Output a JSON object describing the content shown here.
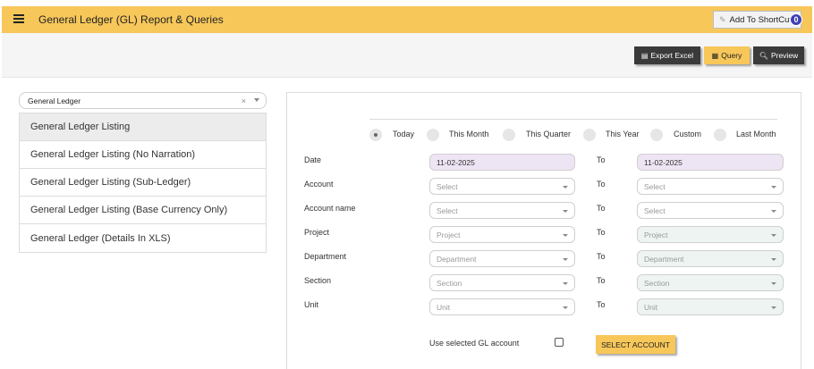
{
  "header": {
    "title": "General Ledger (GL) Report & Queries",
    "shortcut_label": "Add To ShortCut",
    "shortcut_count": "0"
  },
  "toolbar": {
    "export_label": "Export Excel",
    "query_label": "Query",
    "preview_label": "Preview"
  },
  "report_group": {
    "selected": "General Ledger",
    "clear": "×"
  },
  "reports": [
    "General Ledger Listing",
    "General Ledger Listing (No Narration)",
    "General Ledger Listing (Sub-Ledger)",
    "General Ledger Listing (Base Currency Only)",
    "General Ledger (Details In XLS)"
  ],
  "period_options": [
    "Today",
    "This Month",
    "This Quarter",
    "This Year",
    "Custom",
    "Last Month"
  ],
  "period_selected": "Today",
  "form": {
    "to_label": "To",
    "rows": [
      {
        "label": "Date",
        "from": "11-02-2025",
        "to": "11-02-2025"
      },
      {
        "label": "Account",
        "from": "Select",
        "to": "Select"
      },
      {
        "label": "Account name",
        "from": "Select",
        "to": "Select"
      },
      {
        "label": "Project",
        "from": "Project",
        "to": "Project"
      },
      {
        "label": "Department",
        "from": "Department",
        "to": "Department"
      },
      {
        "label": "Section",
        "from": "Section",
        "to": "Section"
      },
      {
        "label": "Unit",
        "from": "Unit",
        "to": "Unit"
      }
    ],
    "use_gl_label": "Use selected GL account",
    "select_account_label": "SELECT ACCOUNT"
  },
  "colors": {
    "accent": "#f7c75a",
    "dark_button": "#3a3a3a",
    "date_field": "#eee5f4",
    "disabled_field": "#eef4f2",
    "badge": "#3f3fb8"
  }
}
